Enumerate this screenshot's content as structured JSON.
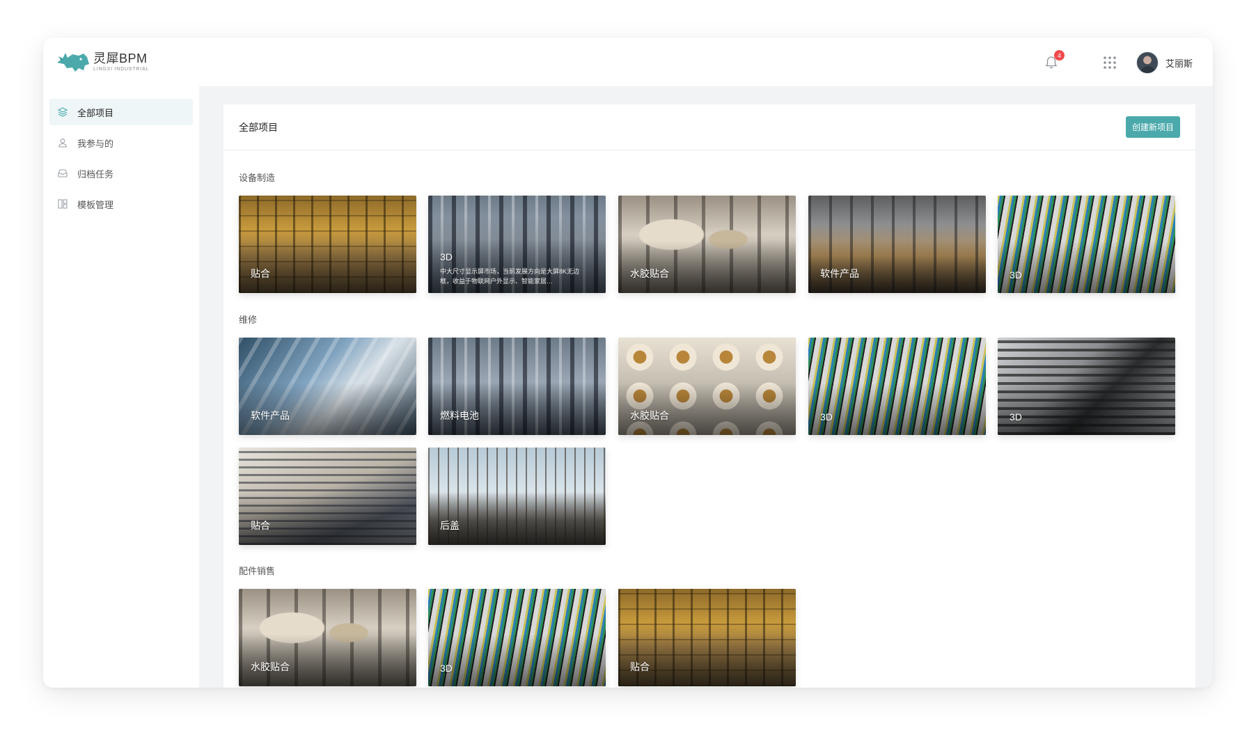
{
  "app": {
    "logo_title": "灵犀BPM",
    "logo_subtitle": "LINGXI INDUSTRIAL",
    "accent_color": "#4ba9ab"
  },
  "header": {
    "notification_count": "4",
    "user_name": "艾丽斯",
    "icons": [
      "bell-icon",
      "apps-grid-icon",
      "avatar"
    ]
  },
  "sidebar": {
    "items": [
      {
        "label": "全部项目",
        "icon": "layers-icon",
        "active": true
      },
      {
        "label": "我参与的",
        "icon": "user-icon",
        "active": false
      },
      {
        "label": "归档任务",
        "icon": "archive-icon",
        "active": false
      },
      {
        "label": "模板管理",
        "icon": "template-icon",
        "active": false
      }
    ]
  },
  "main": {
    "title": "全部项目",
    "create_button": "创建新项目",
    "sections": [
      {
        "title": "设备制造",
        "cards": [
          {
            "label": "贴合",
            "image": "factory"
          },
          {
            "label": "3D",
            "image": "machine",
            "desc": "中大尺寸显示屏市场，当前发展方向是大屏8K无边框，收益于物联网户外显示、智能家居…"
          },
          {
            "label": "水胶贴合",
            "image": "drill"
          },
          {
            "label": "软件产品",
            "image": "lab"
          },
          {
            "label": "3D",
            "image": "wires"
          }
        ]
      },
      {
        "title": "维修",
        "cards": [
          {
            "label": "软件产品",
            "image": "metal"
          },
          {
            "label": "燃料电池",
            "image": "machine"
          },
          {
            "label": "水胶贴合",
            "image": "nuts"
          },
          {
            "label": "3D",
            "image": "wires"
          },
          {
            "label": "3D",
            "image": "calc"
          },
          {
            "label": "贴合",
            "image": "desk"
          },
          {
            "label": "后盖",
            "image": "crane"
          }
        ]
      },
      {
        "title": "配件销售",
        "cards": [
          {
            "label": "水胶贴合",
            "image": "drill"
          },
          {
            "label": "3D",
            "image": "wires"
          },
          {
            "label": "贴合",
            "image": "factory"
          }
        ]
      }
    ]
  }
}
